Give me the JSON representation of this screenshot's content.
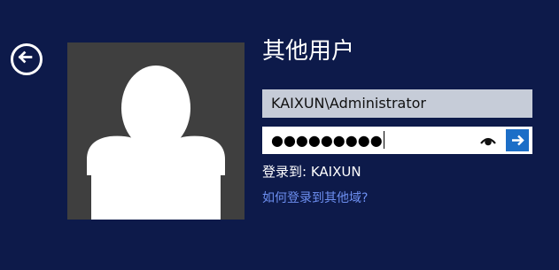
{
  "screen": {
    "title": "其他用户",
    "background_color": "#0d1a4a"
  },
  "back_button": {
    "icon": "arrow-left-circle-icon"
  },
  "user_avatar": {
    "icon": "default-user-silhouette-icon",
    "color": "#3f3f3f"
  },
  "form": {
    "username_value": "KAIXUN\\Administrator",
    "password_masked": "●●●●●●●●●",
    "reveal_icon": "eye-icon",
    "submit_icon": "arrow-right-icon",
    "submit_color": "#1c6ec7"
  },
  "signin_to": "登录到: KAIXUN",
  "other_domain_link": "如何登录到其他域?"
}
